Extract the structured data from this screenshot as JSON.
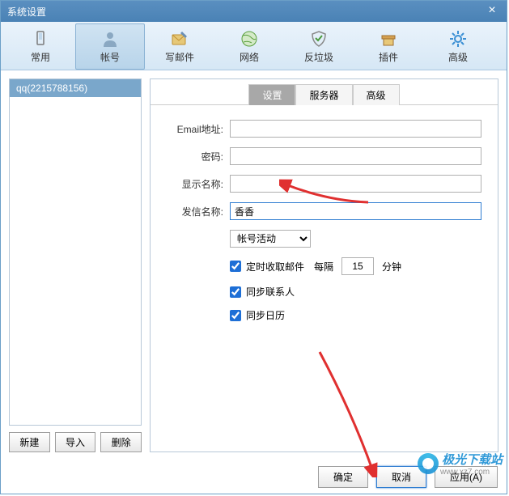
{
  "window": {
    "title": "系统设置"
  },
  "toolbar": [
    {
      "key": "common",
      "label": "常用"
    },
    {
      "key": "account",
      "label": "帐号"
    },
    {
      "key": "compose",
      "label": "写邮件"
    },
    {
      "key": "network",
      "label": "网络"
    },
    {
      "key": "antispam",
      "label": "反垃圾"
    },
    {
      "key": "plugin",
      "label": "插件"
    },
    {
      "key": "advanced",
      "label": "高级"
    }
  ],
  "accounts": [
    {
      "label": "qq(2215788156)"
    }
  ],
  "left_buttons": {
    "new": "新建",
    "import": "导入",
    "delete": "删除"
  },
  "tabs": {
    "settings": "设置",
    "server": "服务器",
    "advanced": "高级"
  },
  "form": {
    "email_label": "Email地址:",
    "email_value": "",
    "password_label": "密码:",
    "password_value": "",
    "display_label": "显示名称:",
    "display_value": "",
    "sender_label": "发信名称:",
    "sender_value": "香香",
    "status_label": "帐号活动",
    "scheduled": {
      "label": "定时收取邮件",
      "prefix": "每隔",
      "value": "15",
      "suffix": "分钟"
    },
    "sync_contacts": "同步联系人",
    "sync_calendar": "同步日历"
  },
  "footer": {
    "ok": "确定",
    "cancel": "取消",
    "apply": "应用(A)"
  },
  "watermark": {
    "brand": "极光下载站",
    "domain": "www.xz7.com"
  }
}
